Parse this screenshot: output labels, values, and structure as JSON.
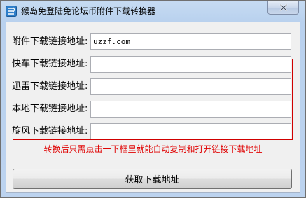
{
  "window": {
    "title": "猴岛免登陆免论坛币附件下载转换器"
  },
  "fields": [
    {
      "label": "附件下载链接地址:",
      "value": "uzzf.com"
    },
    {
      "label": "快车下载链接地址:",
      "value": ""
    },
    {
      "label": "迅雷下载链接地址:",
      "value": ""
    },
    {
      "label": "本地下载链接地址:",
      "value": ""
    },
    {
      "label": "旋风下载链接地址:",
      "value": ""
    }
  ],
  "hint": "转换后只需点击一下框里就能自动复制和打开链接下载地址",
  "button": {
    "label": "获取下载地址"
  },
  "colors": {
    "hint": "#e00000",
    "highlight_box": "#d00000"
  }
}
